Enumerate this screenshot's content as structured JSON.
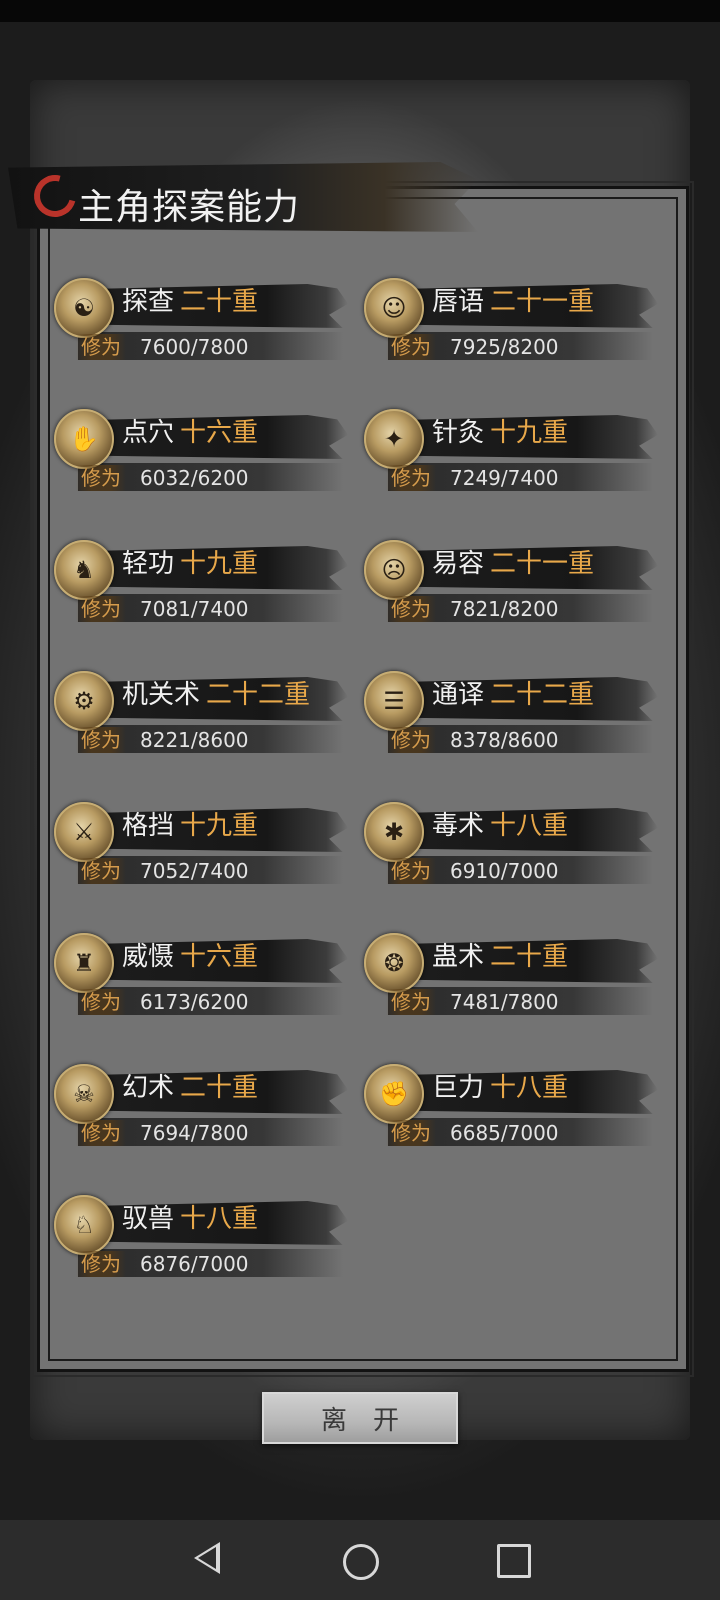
{
  "title": "主角探案能力",
  "xp_label": "修为",
  "skills": [
    {
      "name": "探查",
      "rank": "二十重",
      "xp": "7600/7800",
      "icon": "investigate-icon",
      "glyph": "☯"
    },
    {
      "name": "唇语",
      "rank": "二十一重",
      "xp": "7925/8200",
      "icon": "lip-reading-icon",
      "glyph": "☺"
    },
    {
      "name": "点穴",
      "rank": "十六重",
      "xp": "6032/6200",
      "icon": "acupoint-icon",
      "glyph": "✋"
    },
    {
      "name": "针灸",
      "rank": "十九重",
      "xp": "7249/7400",
      "icon": "acupuncture-icon",
      "glyph": "✦"
    },
    {
      "name": "轻功",
      "rank": "十九重",
      "xp": "7081/7400",
      "icon": "lightness-kungfu-icon",
      "glyph": "♞"
    },
    {
      "name": "易容",
      "rank": "二十一重",
      "xp": "7821/8200",
      "icon": "disguise-icon",
      "glyph": "☹"
    },
    {
      "name": "机关术",
      "rank": "二十二重",
      "xp": "8221/8600",
      "icon": "mechanism-icon",
      "glyph": "⚙"
    },
    {
      "name": "通译",
      "rank": "二十二重",
      "xp": "8378/8600",
      "icon": "translation-icon",
      "glyph": "☰"
    },
    {
      "name": "格挡",
      "rank": "十九重",
      "xp": "7052/7400",
      "icon": "parry-icon",
      "glyph": "⚔"
    },
    {
      "name": "毒术",
      "rank": "十八重",
      "xp": "6910/7000",
      "icon": "poison-spider-icon",
      "glyph": "✱"
    },
    {
      "name": "威慑",
      "rank": "十六重",
      "xp": "6173/6200",
      "icon": "intimidate-icon",
      "glyph": "♜"
    },
    {
      "name": "蛊术",
      "rank": "二十重",
      "xp": "7481/7800",
      "icon": "gu-sorcery-icon",
      "glyph": "❂"
    },
    {
      "name": "幻术",
      "rank": "二十重",
      "xp": "7694/7800",
      "icon": "illusion-icon",
      "glyph": "☠"
    },
    {
      "name": "巨力",
      "rank": "十八重",
      "xp": "6685/7000",
      "icon": "strength-icon",
      "glyph": "✊"
    },
    {
      "name": "驭兽",
      "rank": "十八重",
      "xp": "6876/7000",
      "icon": "beast-taming-icon",
      "glyph": "♘"
    }
  ],
  "leave_button": "离开",
  "colors": {
    "rank": "#e8a84a",
    "xp_label": "#d69c4c",
    "title_ring": "#b9332a"
  },
  "nav": {
    "back": "back-icon",
    "home": "home-icon",
    "recent": "recent-apps-icon"
  }
}
